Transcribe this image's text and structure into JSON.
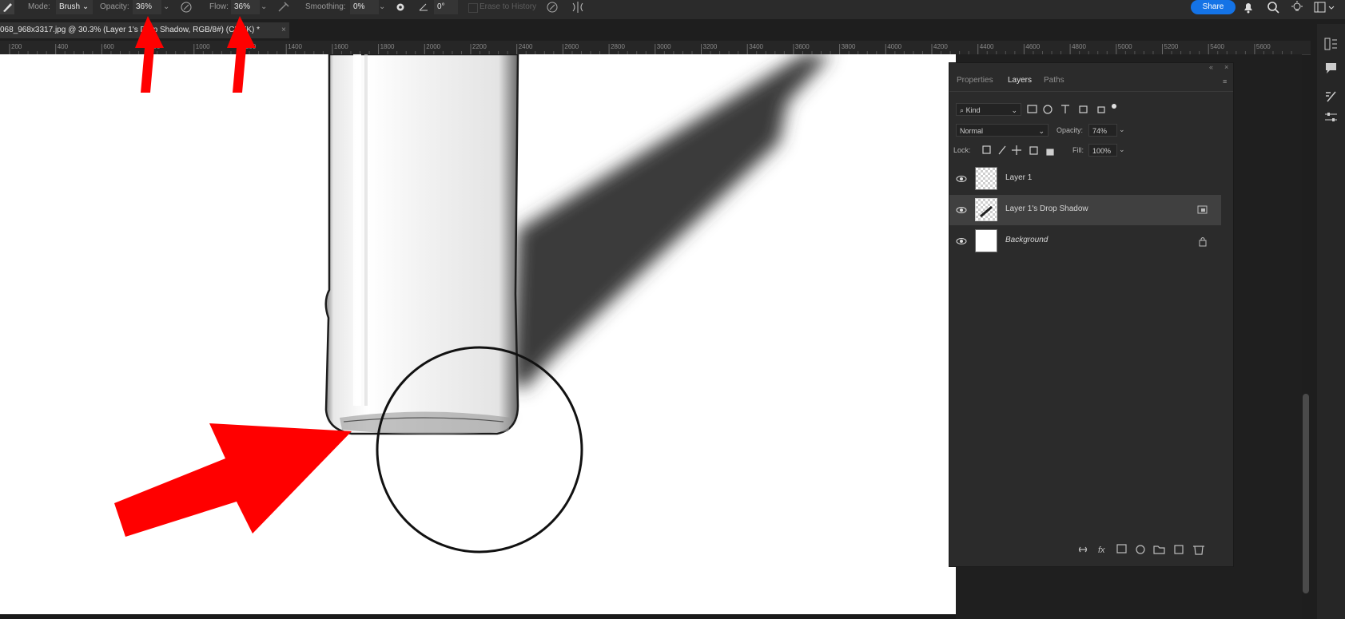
{
  "options_bar": {
    "mode_label": "Mode:",
    "mode_value": "Brush",
    "opacity_label": "Opacity:",
    "opacity_value": "36%",
    "flow_label": "Flow:",
    "flow_value": "36%",
    "smoothing_label": "Smoothing:",
    "smoothing_value": "0%",
    "angle_value": "0°",
    "erase_to_history_label": "Erase to History",
    "share_label": "Share"
  },
  "document": {
    "tab_title": "068_968x3317.jpg @ 30.3% (Layer 1's Drop Shadow, RGB/8#) (CMYK) *",
    "close_glyph": "×"
  },
  "ruler": {
    "ticks": [
      "200",
      "400",
      "600",
      "800",
      "1000",
      "1200",
      "1400",
      "1600",
      "1800",
      "2000",
      "2200",
      "2400",
      "2600",
      "2800",
      "3000",
      "3200",
      "3400",
      "3600",
      "3800",
      "4000",
      "4200",
      "4400",
      "4600",
      "4800",
      "5000",
      "5200",
      "5400",
      "5600"
    ]
  },
  "layers_panel": {
    "tabs": [
      "Properties",
      "Layers",
      "Paths"
    ],
    "active_tab": "Layers",
    "filter_kind": "Kind",
    "blend_mode": "Normal",
    "opacity_label": "Opacity:",
    "opacity_value": "74%",
    "lock_label": "Lock:",
    "fill_label": "Fill:",
    "fill_value": "100%",
    "layers": [
      {
        "name": "Layer 1",
        "selected": false,
        "locked": false
      },
      {
        "name": "Layer 1's Drop Shadow",
        "selected": true,
        "locked": false
      },
      {
        "name": "Background",
        "selected": false,
        "locked": true
      }
    ]
  },
  "colors": {
    "accent": "#1473e6",
    "annotation_arrow": "#ff0000",
    "panel_bg": "#2b2b2b",
    "canvas_bg": "#ffffff"
  },
  "icons": [
    "brush-tool-icon",
    "pressure-opacity-icon",
    "airbrush-icon",
    "smoothing-settings-gear-icon",
    "angle-icon",
    "pressure-size-icon",
    "symmetry-icon",
    "bell-icon",
    "search-icon",
    "lightbulb-icon",
    "workspace-icon",
    "history-icon",
    "comment-icon",
    "brush-settings-icon",
    "adjustments-icon"
  ]
}
